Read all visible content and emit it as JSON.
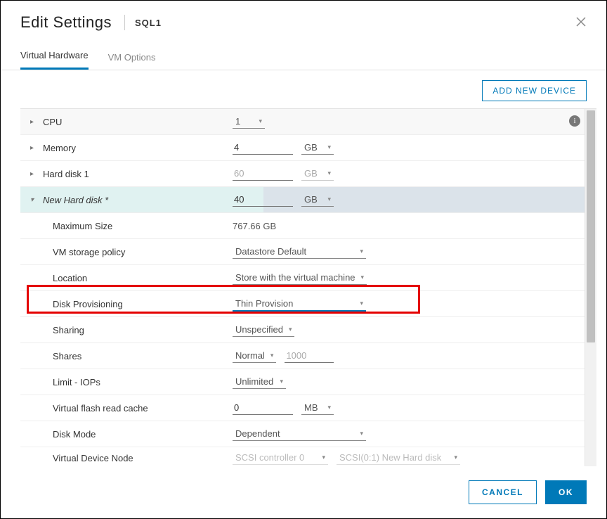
{
  "header": {
    "title": "Edit Settings",
    "subtitle": "SQL1"
  },
  "tabs": [
    {
      "label": "Virtual Hardware",
      "active": true
    },
    {
      "label": "VM Options",
      "active": false
    }
  ],
  "toolbar": {
    "add_new_device": "ADD NEW DEVICE"
  },
  "rows": {
    "cpu_label": "CPU",
    "cpu_value": "1",
    "memory_label": "Memory",
    "memory_value": "4",
    "memory_unit": "GB",
    "hd1_label": "Hard disk 1",
    "hd1_value": "60",
    "hd1_unit": "GB",
    "newhd_label": "New Hard disk *",
    "newhd_value": "40",
    "newhd_unit": "GB",
    "maxsize_label": "Maximum Size",
    "maxsize_value": "767.66 GB",
    "policy_label": "VM storage policy",
    "policy_value": "Datastore Default",
    "location_label": "Location",
    "location_value": "Store with the virtual machine",
    "prov_label": "Disk Provisioning",
    "prov_value": "Thin Provision",
    "sharing_label": "Sharing",
    "sharing_value": "Unspecified",
    "shares_label": "Shares",
    "shares_value": "Normal",
    "shares_num": "1000",
    "limit_label": "Limit - IOPs",
    "limit_value": "Unlimited",
    "flash_label": "Virtual flash read cache",
    "flash_value": "0",
    "flash_unit": "MB",
    "mode_label": "Disk Mode",
    "mode_value": "Dependent",
    "node_label": "Virtual Device Node",
    "node_controller": "SCSI controller 0",
    "node_disk": "SCSI(0:1) New Hard disk"
  },
  "footer": {
    "cancel": "CANCEL",
    "ok": "OK"
  }
}
